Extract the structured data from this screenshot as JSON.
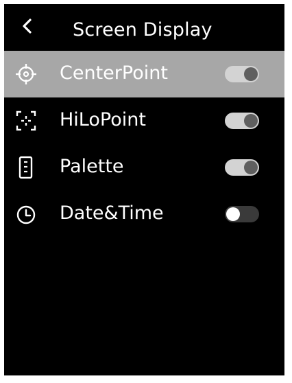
{
  "header": {
    "back_icon": "chevron-left-icon",
    "title": "Screen Display"
  },
  "colors": {
    "background": "#000000",
    "selected_row": "#a7a7a7",
    "text": "#ffffff",
    "toggle_on_track": "#d3d3d3",
    "toggle_on_knob": "#5f5f5f",
    "toggle_off_track": "#3a3a3a",
    "toggle_off_knob": "#ffffff"
  },
  "menu": {
    "selected_index": 0,
    "items": [
      {
        "label": "CenterPoint",
        "icon": "crosshair-icon",
        "enabled": true
      },
      {
        "label": "HiLoPoint",
        "icon": "focus-bracket-icon",
        "enabled": true
      },
      {
        "label": "Palette",
        "icon": "palette-bar-icon",
        "enabled": true
      },
      {
        "label": "Date&Time",
        "icon": "clock-icon",
        "enabled": false
      }
    ]
  }
}
